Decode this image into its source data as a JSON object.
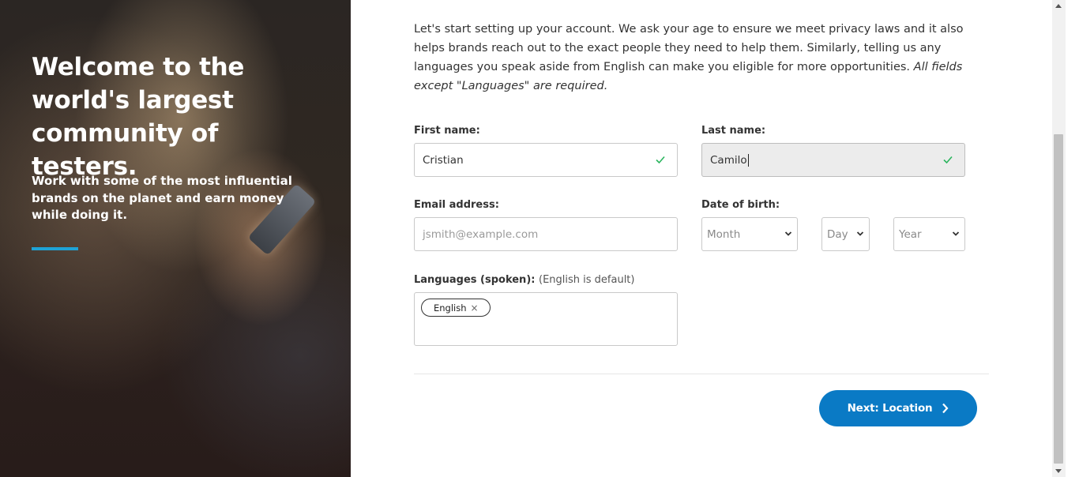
{
  "hero": {
    "title": "Welcome to the world's largest community of testers.",
    "subtitle": "Work with some of the most influential brands on the planet and earn money while doing it.",
    "accent_color": "#1fa3d6"
  },
  "intro": {
    "text": "Let's start setting up your account. We ask your age to ensure we meet privacy laws and it also helps brands reach out to the exact people they need to help them. Similarly, telling us any languages you speak aside from English can make you eligible for more opportunities. ",
    "emphasis": "All fields except \"Languages\" are required."
  },
  "form": {
    "first_name": {
      "label": "First name:",
      "value": "Cristian"
    },
    "last_name": {
      "label": "Last name:",
      "value": "Camilo"
    },
    "email": {
      "label": "Email address:",
      "placeholder": "jsmith@example.com"
    },
    "dob": {
      "label": "Date of birth:",
      "month": "Month",
      "day": "Day",
      "year": "Year"
    },
    "languages": {
      "label": "Languages (spoken):",
      "note": "(English is default)",
      "tags": [
        "English"
      ],
      "remove_glyph": "×"
    },
    "valid_color": "#2bb55e"
  },
  "actions": {
    "next_label": "Next: Location",
    "next_color": "#0a7ac5"
  }
}
